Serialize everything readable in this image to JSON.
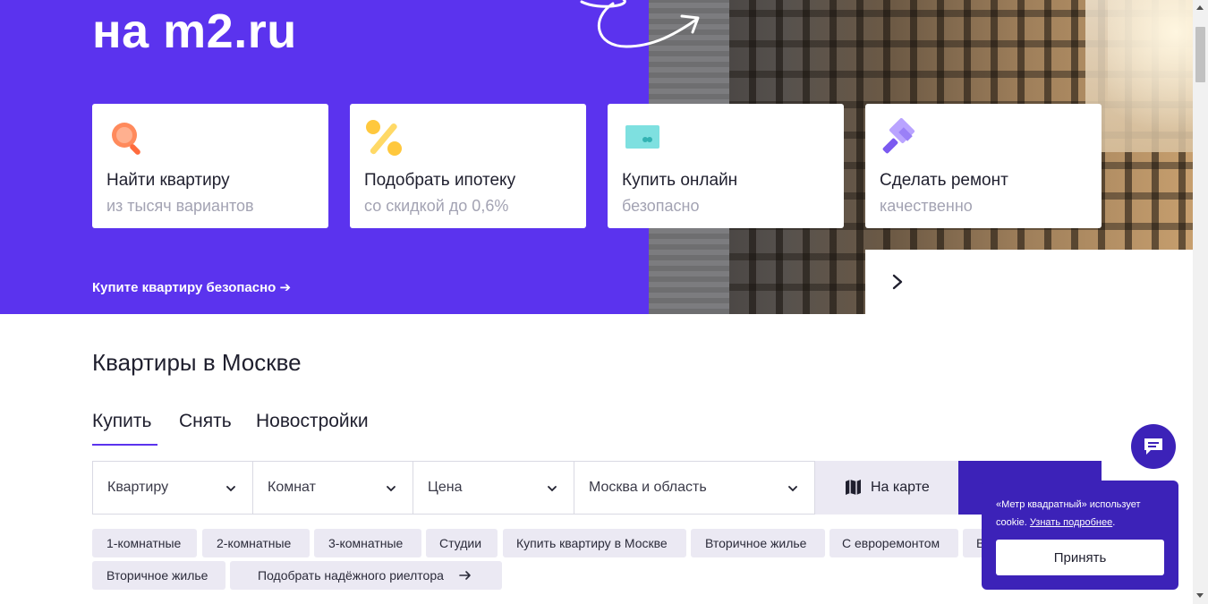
{
  "hero": {
    "title": "на m2.ru",
    "cards": [
      {
        "title": "Найти квартиру",
        "subtitle": "из тысяч вариантов",
        "icon": "search-icon"
      },
      {
        "title": "Подобрать ипотеку",
        "subtitle": "со скидкой до 0,6%",
        "icon": "percent-icon"
      },
      {
        "title": "Купить онлайн",
        "subtitle": "безопасно",
        "icon": "card-icon"
      },
      {
        "title": "Сделать ремонт",
        "subtitle": "качественно",
        "icon": "paint-roller-icon"
      }
    ],
    "link": "Купите квартиру безопасно ➔"
  },
  "search": {
    "title": "Квартиры в Москве",
    "tabs": [
      "Купить",
      "Снять",
      "Новостройки"
    ],
    "active_tab": "Купить",
    "filters": [
      "Квартиру",
      "Комнат",
      "Цена",
      "Москва и область"
    ],
    "map_button": "На карте"
  },
  "chips": {
    "row1": [
      "1-комнатные",
      "2-комнатные",
      "3-комнатные",
      "Студии",
      "Купить квартиру в Москве",
      "Вторичное жилье",
      "С евроремонтом",
      "В"
    ],
    "row2": [
      "Вторичное жилье",
      "Подобрать надёжного риелтора"
    ]
  },
  "cookie": {
    "text": "«Метр квадратный» использует cookie.",
    "link": "Узнать подробнее",
    "dot": ".",
    "accept": "Принять"
  },
  "colors": {
    "brand": "#5b33ee",
    "brand_dark": "#3c22b8",
    "chip_bg": "#ebe9f3",
    "muted_text": "#a3a3b3"
  }
}
